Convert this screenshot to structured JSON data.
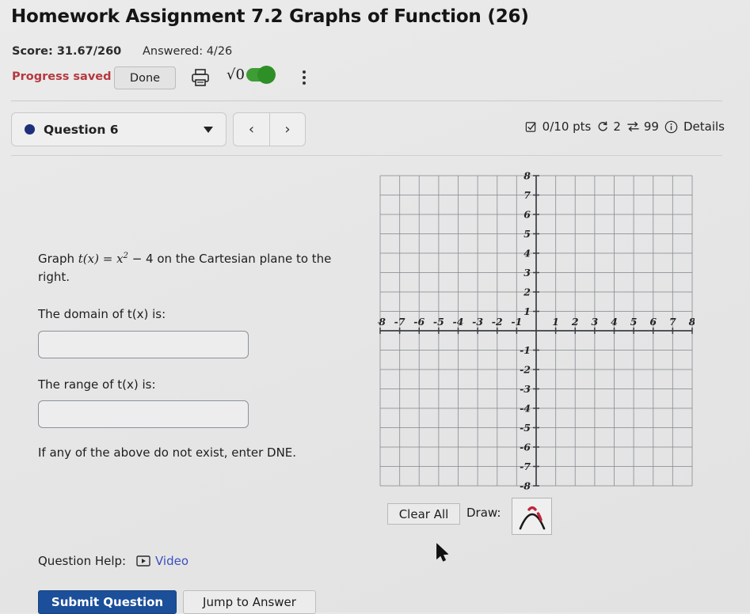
{
  "header": {
    "title": "Homework Assignment 7.2 Graphs of Function (26)",
    "score_label": "Score: 31.67/260",
    "answered_label": "Answered: 4/26",
    "progress_saved": "Progress saved",
    "done_label": "Done",
    "print_icon": "printer-icon",
    "sqrt_glyph": "√0",
    "sqrt_toggle_state": "on",
    "kebab_icon": "more-vertical-icon"
  },
  "question_bar": {
    "selected_question": "Question 6",
    "dot_color": "#1f2f7a",
    "prev_label": "‹",
    "next_label": "›",
    "points": "0/10 pts",
    "attempts": "2",
    "exchanges": "99",
    "details_label": "Details"
  },
  "main": {
    "prompt_prefix": "Graph ",
    "prompt_fn": "t(x) = x",
    "prompt_exp": "2",
    "prompt_rest": " − 4 on the Cartesian plane to the right.",
    "domain_label_pre": "The domain of ",
    "domain_label_fn": "t(x)",
    "domain_label_post": " is:",
    "range_label_pre": "The range of ",
    "range_label_fn": "t(x)",
    "range_label_post": " is:",
    "domain_value": "",
    "range_value": "",
    "domain_placeholder": "",
    "range_placeholder": "",
    "dne_note": "If any of the above do not exist, enter DNE."
  },
  "graph_tools": {
    "clear_all_label": "Clear All",
    "draw_label": "Draw:",
    "draw_tool_icon": "parabola-icon"
  },
  "footer": {
    "help_label": "Question Help:",
    "video_icon": "video-play-icon",
    "video_label": "Video",
    "submit_label": "Submit Question",
    "jump_label": "Jump to Answer",
    "submit_color": "#1b4f99"
  },
  "chart_data": {
    "type": "line",
    "title": "",
    "xlabel": "",
    "ylabel": "",
    "xlim": [
      -8,
      8
    ],
    "ylim": [
      -8,
      8
    ],
    "grid": true,
    "x_ticks": [
      -8,
      -7,
      -6,
      -5,
      -4,
      -3,
      -2,
      -1,
      1,
      2,
      3,
      4,
      5,
      6,
      7,
      8
    ],
    "y_ticks": [
      8,
      7,
      6,
      5,
      4,
      3,
      2,
      1,
      -1,
      -2,
      -3,
      -4,
      -5,
      -6,
      -7,
      -8
    ],
    "series": [],
    "note": "empty Cartesian grid; no curve plotted yet"
  }
}
